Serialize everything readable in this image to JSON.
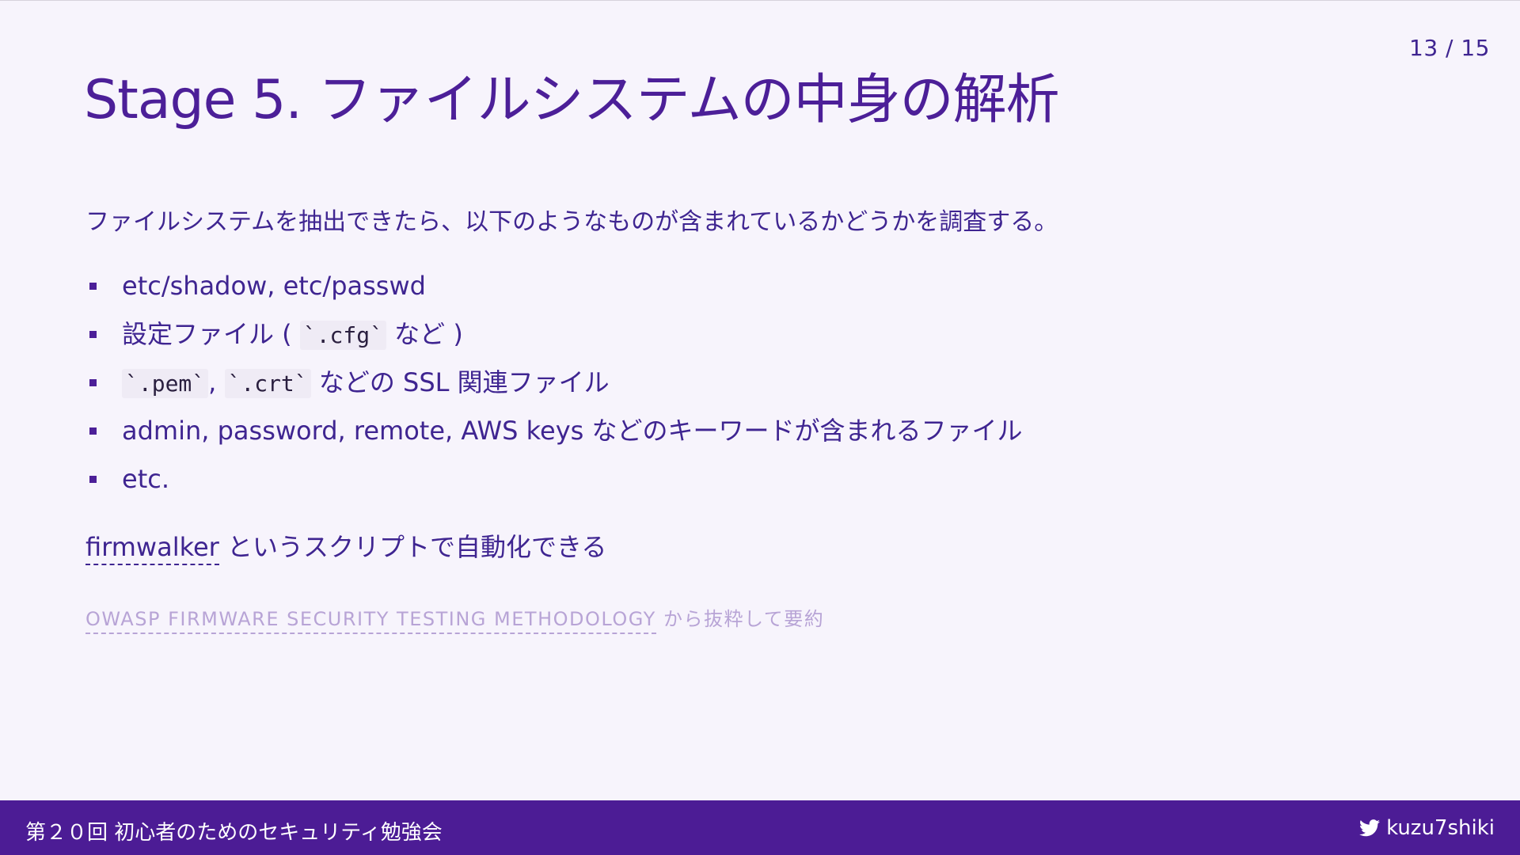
{
  "page_number": "13 / 15",
  "title": "Stage 5. ファイルシステムの中身の解析",
  "lead": "ファイルシステムを抽出できたら、以下のようなものが含まれているかどうかを調査する。",
  "bullets": {
    "b1": "etc/shadow, etc/passwd",
    "b2_pre": "設定ファイル ( ",
    "b2_code": "`.cfg`",
    "b2_post": " など )",
    "b3_code1": "`.pem`",
    "b3_sep": ", ",
    "b3_code2": "`.crt`",
    "b3_post": " などの SSL 関連ファイル",
    "b4": "admin, password, remote, AWS keys などのキーワードが含まれるファイル",
    "b5": "etc."
  },
  "firmwalker": {
    "link": "firmwalker",
    "text": " というスクリプトで自動化できる"
  },
  "source": {
    "link": "OWASP FIRMWARE SECURITY TESTING METHODOLOGY",
    "text": " から抜粋して要約"
  },
  "footer": {
    "left": "第２０回 初心者のためのセキュリティ勉強会",
    "right": "kuzu7shiki",
    "icon": "twitter-bird-icon"
  },
  "colors": {
    "background": "#f7f4fc",
    "primary": "#4c1f98",
    "footer": "#4c1c95",
    "muted": "#b8a4d6"
  }
}
